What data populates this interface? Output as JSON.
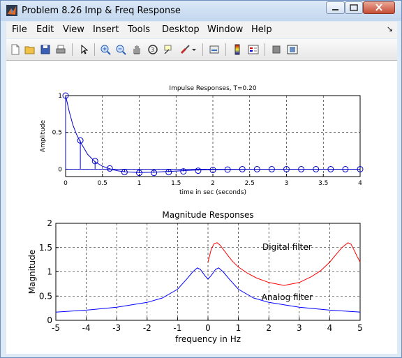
{
  "window": {
    "title": "Problem 8.26 Imp & Freq Response"
  },
  "menu": [
    "File",
    "Edit",
    "View",
    "Insert",
    "Tools",
    "Desktop",
    "Window",
    "Help"
  ],
  "toolbar_icons": [
    "new-figure-icon",
    "open-file-icon",
    "save-icon",
    "print-icon",
    "pointer-icon",
    "zoom-in-icon",
    "zoom-out-icon",
    "pan-icon",
    "rotate-3d-icon",
    "data-cursor-icon",
    "brush-icon",
    "brush-menu-icon",
    "link-plot-icon",
    "colorbar-icon",
    "legend-icon",
    "hide-plot-tools-icon",
    "show-plot-tools-icon"
  ],
  "colors": {
    "analog": "#0000ff",
    "digital": "#ff0000",
    "stem": "#0000cc"
  },
  "chart_data": [
    {
      "type": "line",
      "title": "Impulse Responses, T=0.20",
      "xlabel": "time in sec (seconds)",
      "ylabel": "Amplitude",
      "xlim": [
        0,
        4
      ],
      "ylim": [
        -0.1,
        1.0
      ],
      "xticks": [
        "0",
        "0.5",
        "1",
        "1.5",
        "2",
        "2.5",
        "3",
        "3.5",
        "4"
      ],
      "yticks": [
        "0",
        "0.5",
        "1"
      ],
      "grid": true,
      "series": [
        {
          "style": "curve",
          "x": [
            0,
            0.05,
            0.1,
            0.15,
            0.2,
            0.3,
            0.4,
            0.5,
            0.6,
            0.7,
            0.8,
            1.0,
            1.2,
            1.4,
            1.6,
            1.8,
            2.0,
            2.5,
            3.0,
            3.5,
            4.0
          ],
          "y": [
            1.0,
            0.78,
            0.6,
            0.47,
            0.37,
            0.2,
            0.1,
            0.04,
            0.005,
            -0.02,
            -0.035,
            -0.045,
            -0.04,
            -0.03,
            -0.02,
            -0.01,
            -0.005,
            0,
            0,
            0,
            0
          ]
        },
        {
          "style": "stem",
          "x": [
            0,
            0.2,
            0.4,
            0.6,
            0.8,
            1.0,
            1.2,
            1.4,
            1.6,
            1.8,
            2.0,
            2.2,
            2.4,
            2.6,
            2.8,
            3.0,
            3.2,
            3.4,
            3.6,
            3.8,
            4.0
          ],
          "y": [
            1.0,
            0.39,
            0.11,
            0.01,
            -0.04,
            -0.05,
            -0.05,
            -0.04,
            -0.03,
            -0.02,
            -0.01,
            -0.005,
            0,
            0,
            0,
            0,
            0,
            0,
            0,
            0,
            0
          ]
        }
      ]
    },
    {
      "type": "line",
      "title": "Magnitude Responses",
      "xlabel": "frequency in Hz",
      "ylabel": "Magnitude",
      "xlim": [
        -5,
        5
      ],
      "ylim": [
        0,
        2
      ],
      "xticks": [
        "-5",
        "-4",
        "-3",
        "-2",
        "-1",
        "0",
        "1",
        "2",
        "3",
        "4",
        "5"
      ],
      "yticks": [
        "0",
        "0.5",
        "1",
        "1.5",
        "2"
      ],
      "grid": true,
      "annotations": [
        "Digital filter",
        "Analog filter"
      ],
      "series": [
        {
          "style": "analog",
          "x": [
            -5,
            -4,
            -3,
            -2,
            -1.5,
            -1,
            -0.7,
            -0.5,
            -0.35,
            -0.25,
            -0.1,
            0,
            0.1,
            0.25,
            0.35,
            0.5,
            0.7,
            1,
            1.5,
            2,
            3,
            4,
            5
          ],
          "y": [
            0.17,
            0.21,
            0.27,
            0.37,
            0.46,
            0.64,
            0.85,
            1.0,
            1.08,
            1.05,
            0.92,
            0.85,
            0.92,
            1.05,
            1.08,
            1.0,
            0.85,
            0.64,
            0.46,
            0.37,
            0.27,
            0.21,
            0.17
          ]
        },
        {
          "style": "digital",
          "x": [
            0,
            0.1,
            0.2,
            0.3,
            0.4,
            0.6,
            0.8,
            1,
            1.3,
            1.6,
            2,
            2.5,
            3,
            3.4,
            3.7,
            4,
            4.2,
            4.4,
            4.6,
            4.7,
            4.8,
            4.9,
            5
          ],
          "y": [
            1.2,
            1.45,
            1.58,
            1.6,
            1.55,
            1.38,
            1.22,
            1.1,
            0.97,
            0.87,
            0.78,
            0.72,
            0.78,
            0.9,
            1.02,
            1.2,
            1.35,
            1.5,
            1.6,
            1.57,
            1.45,
            1.32,
            1.2
          ]
        }
      ]
    }
  ]
}
